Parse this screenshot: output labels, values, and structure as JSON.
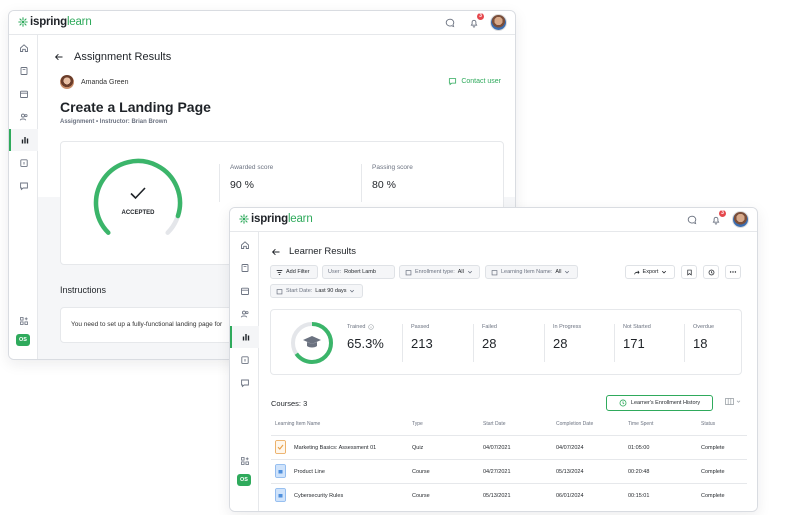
{
  "brand": {
    "name": "ispring",
    "suffix": "learn",
    "accent": "#2faa5c"
  },
  "notifications": {
    "count": "3"
  },
  "assignment": {
    "page_title": "Assignment Results",
    "user_name": "Amanda Green",
    "contact_label": "Contact user",
    "title": "Create a Landing Page",
    "subtitle": "Assignment • Instructor: Brian Brown",
    "status": "ACCEPTED",
    "score_fraction": 0.9,
    "awarded_label": "Awarded score",
    "awarded_value": "90 %",
    "passing_label": "Passing score",
    "passing_value": "80 %",
    "instructions_title": "Instructions",
    "instructions_text": "You need to set up a fully-functional landing page for"
  },
  "learner": {
    "page_title": "Learner Results",
    "filters": {
      "add_filter": "Add Filter",
      "user_label": "User:",
      "user_value": "Robert Lamb",
      "enrollment_label": "Enrollment type:",
      "enrollment_value": "All",
      "item_label": "Learning Item Name:",
      "item_value": "All",
      "date_label": "Start Date:",
      "date_value": "Last 90 days",
      "export": "Export"
    },
    "stats": {
      "trained_label": "Trained",
      "trained_value": "65.3%",
      "trained_fraction": 0.653,
      "passed_label": "Passed",
      "passed_value": "213",
      "failed_label": "Failed",
      "failed_value": "28",
      "progress_label": "In Progress",
      "progress_value": "28",
      "notstarted_label": "Not Started",
      "notstarted_value": "171",
      "overdue_label": "Overdue",
      "overdue_value": "18"
    },
    "courses_label": "Courses: 3",
    "history_button": "Learner's Enrollment History",
    "columns": [
      "Learning Item Name",
      "Type",
      "Start Date",
      "Completion Date",
      "Time Spent",
      "Status"
    ],
    "rows": [
      {
        "name": "Marketing Basics: Assessment 01",
        "type": "Quiz",
        "start": "04/07/2021",
        "completion": "04/07/2024",
        "time": "01:05:00",
        "status": "Complete",
        "icon": "quiz-icon"
      },
      {
        "name": "Product Line",
        "type": "Course",
        "start": "04/27/2021",
        "completion": "05/13/2024",
        "time": "00:20:48",
        "status": "Complete",
        "icon": "course-icon"
      },
      {
        "name": "Cybersecurity Rules",
        "type": "Course",
        "start": "05/13/2021",
        "completion": "06/01/2024",
        "time": "00:15:01",
        "status": "Complete",
        "icon": "course-icon"
      }
    ]
  },
  "sidebar_badge": "OS"
}
